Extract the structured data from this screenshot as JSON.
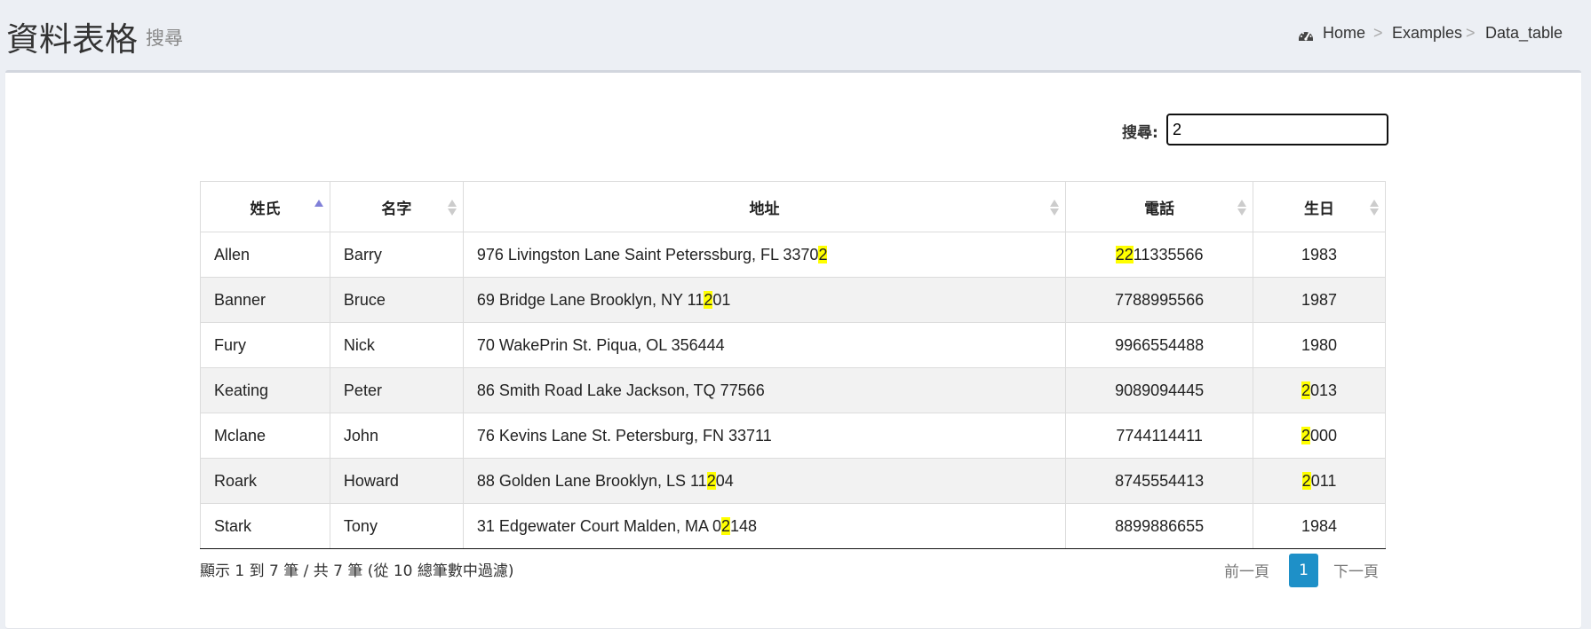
{
  "header": {
    "title": "資料表格",
    "subtitle": "搜尋",
    "breadcrumb": [
      "Home",
      "Examples",
      "Data_table"
    ],
    "breadcrumb_separator": ">",
    "home_icon": "dashboard-icon"
  },
  "search": {
    "label": "搜尋:",
    "value": "2"
  },
  "table": {
    "columns": [
      "姓氏",
      "名字",
      "地址",
      "電話",
      "生日"
    ],
    "sorted_column": "姓氏",
    "sort_direction": "ascending",
    "rows": [
      [
        "Allen",
        "Barry",
        "976 Livingston Lane Saint Peterssburg, FL 33702",
        "2211335566",
        "1983"
      ],
      [
        "Banner",
        "Bruce",
        "69 Bridge Lane Brooklyn, NY 11201",
        "7788995566",
        "1987"
      ],
      [
        "Fury",
        "Nick",
        "70 WakePrin St. Piqua, OL 356444",
        "9966554488",
        "1980"
      ],
      [
        "Keating",
        "Peter",
        "86 Smith Road Lake Jackson, TQ 77566",
        "9089094445",
        "2013"
      ],
      [
        "Mclane",
        "John",
        "76 Kevins Lane St. Petersburg, FN 33711",
        "7744114411",
        "2000"
      ],
      [
        "Roark",
        "Howard",
        "88 Golden Lane Brooklyn, LS 11204",
        "8745554413",
        "2011"
      ],
      [
        "Stark",
        "Tony",
        "31 Edgewater Court Malden, MA 02148",
        "8899886655",
        "1984"
      ]
    ]
  },
  "info_text": "顯示 1 到 7 筆 / 共 7 筆 (從 10 總筆數中過濾)",
  "pagination": {
    "prev": "前一頁",
    "current": "1",
    "next": "下一頁"
  },
  "colors": {
    "highlight": "#ffff00",
    "active_page": "#1e90c8",
    "sort_active": "#8080d8",
    "sort_inactive": "#cccccc"
  }
}
